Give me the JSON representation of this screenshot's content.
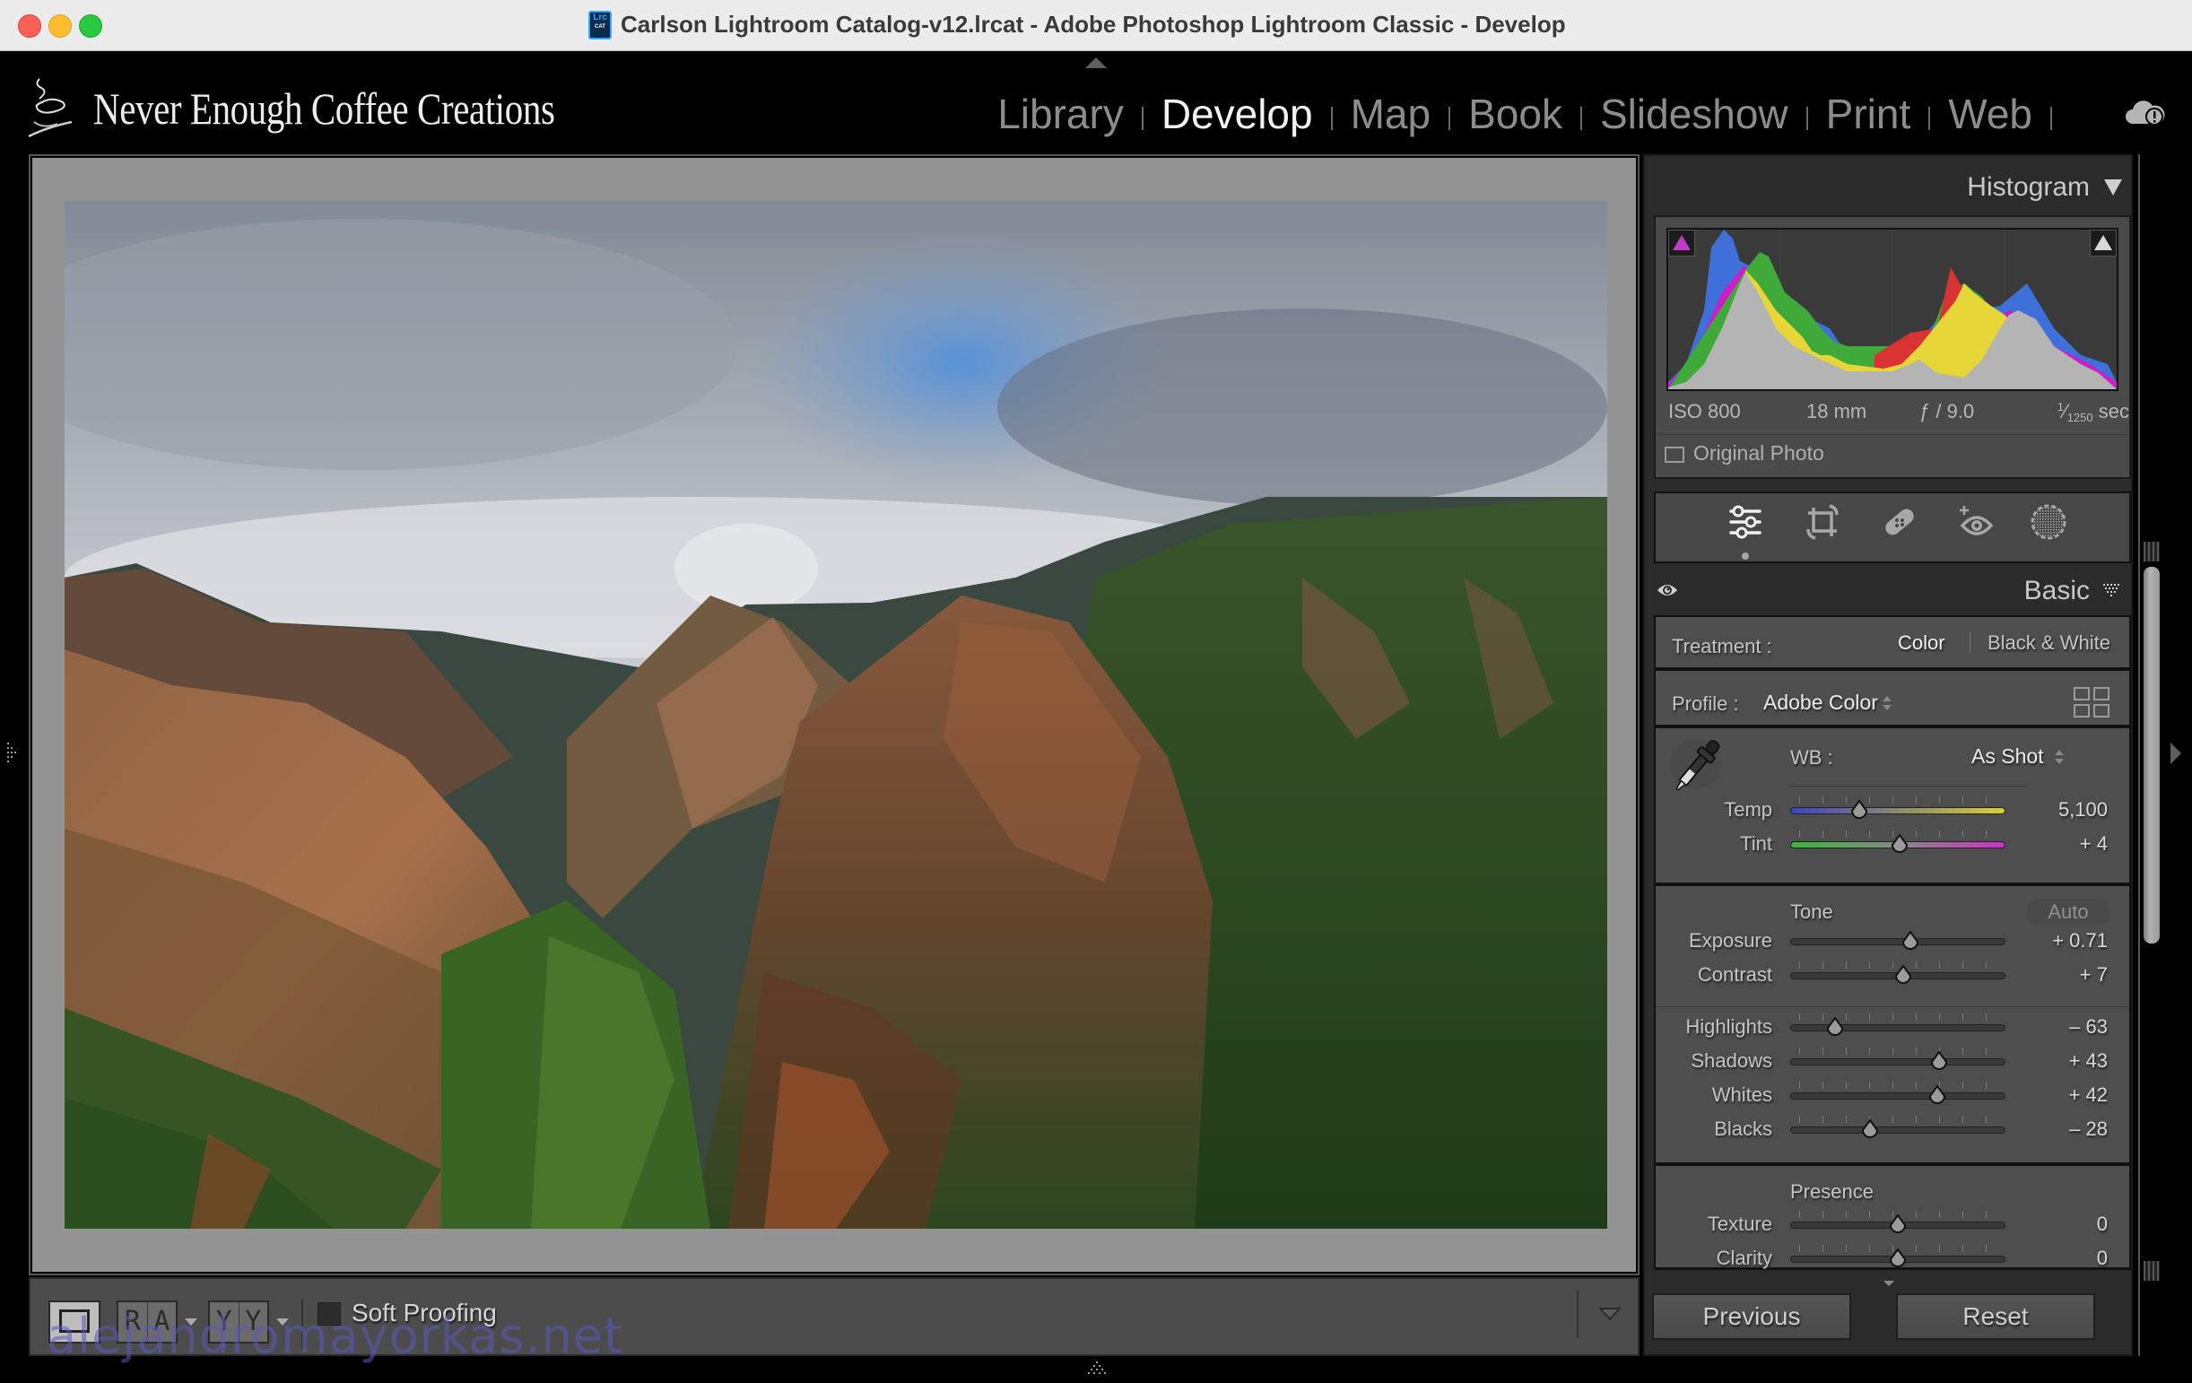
{
  "window": {
    "title": "Carlson Lightroom Catalog-v12.lrcat - Adobe Photoshop Lightroom Classic - Develop",
    "app_icon": {
      "top": "Lrc",
      "bottom": "CAT"
    },
    "controls": [
      "close",
      "minimize",
      "zoom"
    ]
  },
  "identity_plate": "Never Enough Coffee Creations",
  "modules": [
    {
      "label": "Library",
      "active": false
    },
    {
      "label": "Develop",
      "active": true
    },
    {
      "label": "Map",
      "active": false
    },
    {
      "label": "Book",
      "active": false
    },
    {
      "label": "Slideshow",
      "active": false
    },
    {
      "label": "Print",
      "active": false
    },
    {
      "label": "Web",
      "active": false
    }
  ],
  "cloud_status_icon": "cloud-alert-icon",
  "photo": {
    "description": "Aerial view of green and red-brown canyon ridges under a cloudy sky with patches of blue"
  },
  "toolbar": {
    "view_loupe_icon": "loupe-view-icon",
    "before_after_lr": "RA",
    "before_after_tb": "YY",
    "soft_proofing_label": "Soft Proofing",
    "soft_proofing_checked": false,
    "watermark": "alejandromayorkas.net"
  },
  "histogram": {
    "title": "Histogram",
    "exif": {
      "iso": "ISO 800",
      "focal_length": "18 mm",
      "aperture": "ƒ / 9.0",
      "shutter_num": "1",
      "shutter_den": "1250",
      "shutter_unit": "sec"
    },
    "original_photo_label": "Original Photo",
    "original_photo_checked": false,
    "colors": {
      "blue": "#3f6fd8",
      "magenta": "#d21bc7",
      "green": "#3faa3a",
      "yellow": "#e6d638",
      "red": "#d83232",
      "luminance": "#b4b4b4",
      "cyan": "#2fc3c8"
    }
  },
  "tools": [
    {
      "name": "edit-sliders-icon",
      "active": true
    },
    {
      "name": "crop-icon",
      "active": false
    },
    {
      "name": "healing-icon",
      "active": false
    },
    {
      "name": "red-eye-icon",
      "active": false
    },
    {
      "name": "masking-icon",
      "active": false
    }
  ],
  "basic": {
    "title": "Basic",
    "treatment_label": "Treatment :",
    "treatment_options": [
      "Color",
      "Black & White"
    ],
    "treatment_selected": "Color",
    "profile_label": "Profile :",
    "profile_value": "Adobe Color",
    "wb_label": "WB :",
    "wb_value": "As Shot",
    "tone_title": "Tone",
    "auto_label": "Auto",
    "presence_title": "Presence",
    "sliders": {
      "temp": {
        "label": "Temp",
        "value": "5,100",
        "position": 0.32
      },
      "tint": {
        "label": "Tint",
        "value": "+ 4",
        "position": 0.51
      },
      "exposure": {
        "label": "Exposure",
        "value": "+ 0.71",
        "position": 0.559
      },
      "contrast": {
        "label": "Contrast",
        "value": "+ 7",
        "position": 0.525
      },
      "highlights": {
        "label": "Highlights",
        "value": "– 63",
        "position": 0.21
      },
      "shadows": {
        "label": "Shadows",
        "value": "+ 43",
        "position": 0.69
      },
      "whites": {
        "label": "Whites",
        "value": "+ 42",
        "position": 0.685
      },
      "blacks": {
        "label": "Blacks",
        "value": "– 28",
        "position": 0.37
      },
      "texture": {
        "label": "Texture",
        "value": "0",
        "position": 0.5
      },
      "clarity": {
        "label": "Clarity",
        "value": "0",
        "position": 0.5
      }
    }
  },
  "buttons": {
    "previous": "Previous",
    "reset": "Reset"
  }
}
